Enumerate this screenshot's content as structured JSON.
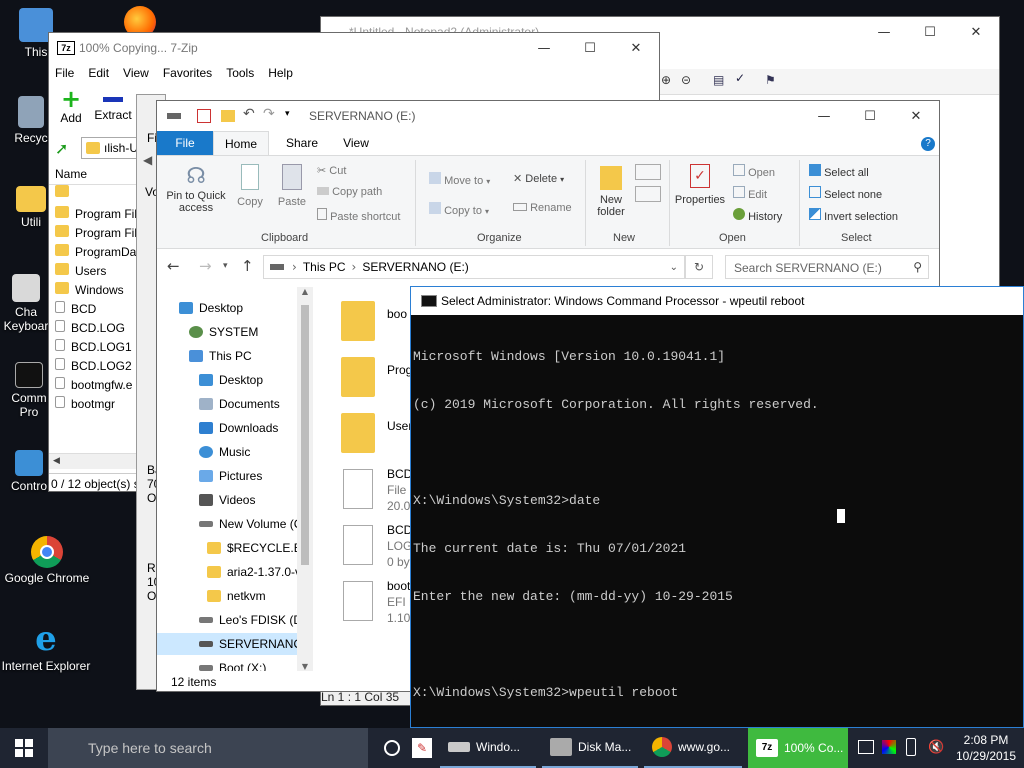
{
  "desktop": {
    "icons": [
      {
        "label": "This"
      },
      {
        "label": "Recyc"
      },
      {
        "label": "Utili"
      },
      {
        "label": "Cha"
      },
      {
        "label": "Keyboar"
      },
      {
        "label": "Comm"
      },
      {
        "label": "Pro"
      },
      {
        "label": "Contro"
      },
      {
        "label": "Google Chrome"
      },
      {
        "label": "Internet Explorer"
      }
    ]
  },
  "notepad": {
    "title": "*Untitled - Notepad2 (Administrator)",
    "status": "Ln 1 : 1    Col 35"
  },
  "zip": {
    "title": "100% Copying... 7-Zip",
    "menu": [
      "File",
      "Edit",
      "View",
      "Favorites",
      "Tools",
      "Help"
    ],
    "toolbar": {
      "add": "Add",
      "extract": "Extract"
    },
    "path": "ılish-U",
    "col_name": "Name",
    "files": [
      "",
      "Program File",
      "Program File",
      "ProgramDat",
      "Users",
      "Windows",
      "BCD",
      "BCD.LOG",
      "BCD.LOG1",
      "BCD.LOG2",
      "bootmgfw.e",
      "bootmgr"
    ],
    "status": "0 / 12 object(s) s",
    "fm_label": "Fi",
    "vol_label": "Vo",
    "side_frag": [
      {
        "a": "Ba",
        "b": "70",
        "c": "O"
      },
      {
        "a": "Re",
        "b": "10",
        "c": "O"
      }
    ]
  },
  "explorer": {
    "title": "SERVERNANO (E:)",
    "tabs": [
      "File",
      "Home",
      "Share",
      "View"
    ],
    "ribbon": {
      "pin": "Pin to Quick access",
      "copy": "Copy",
      "paste": "Paste",
      "cut": "Cut",
      "copy_path": "Copy path",
      "paste_shortcut": "Paste shortcut",
      "clipboard": "Clipboard",
      "move_to": "Move to",
      "copy_to": "Copy to",
      "delete": "Delete",
      "rename": "Rename",
      "organize": "Organize",
      "new_folder": "New folder",
      "new": "New",
      "properties": "Properties",
      "open_btn": "Open",
      "edit": "Edit",
      "history": "History",
      "open_grp": "Open",
      "select_all": "Select all",
      "select_none": "Select none",
      "invert": "Invert selection",
      "select": "Select"
    },
    "address": {
      "this_pc": "This PC",
      "drive": "SERVERNANO (E:)"
    },
    "search_placeholder": "Search SERVERNANO (E:)",
    "tree": [
      "Desktop",
      "SYSTEM",
      "This PC",
      "Desktop",
      "Documents",
      "Downloads",
      "Music",
      "Pictures",
      "Videos",
      "New Volume (C",
      "$RECYCLE.BIN",
      "aria2-1.37.0-v",
      "netkvm",
      "Leo's FDISK (D:",
      "SERVERNANO",
      "Boot (X:)"
    ],
    "files": [
      {
        "name": "boo",
        "l2": "",
        "l3": ""
      },
      {
        "name": "Prog",
        "l2": "",
        "l3": ""
      },
      {
        "name": "User",
        "l2": "",
        "l3": ""
      },
      {
        "name": "BCD",
        "l2": "File",
        "l3": "20.0"
      },
      {
        "name": "BCD",
        "l2": "LOG",
        "l3": "0 byt"
      },
      {
        "name": "boot",
        "l2": "EFI F",
        "l3": "1.10"
      }
    ],
    "status": "12 items"
  },
  "cmd": {
    "title": "Select Administrator: Windows Command Processor - wpeutil  reboot",
    "lines": [
      "Microsoft Windows [Version 10.0.19041.1]",
      "(c) 2019 Microsoft Corporation. All rights reserved.",
      "",
      "X:\\Windows\\System32>date",
      "The current date is: Thu 07/01/2021",
      "Enter the new date: (mm-dd-yy) 10-29-2015",
      "",
      "X:\\Windows\\System32>wpeutil reboot"
    ]
  },
  "taskbar": {
    "search_placeholder": "Type here to search",
    "buttons": [
      "Windo...",
      "Disk Ma...",
      "www.go...",
      "100% Co..."
    ],
    "time": "2:08 PM",
    "date": "10/29/2015"
  },
  "colors": {
    "accent": "#0078d7",
    "cmd_bg": "#0c0c0c",
    "taskbar_bg": "#1f2532",
    "active_task": "#3fba3f"
  }
}
